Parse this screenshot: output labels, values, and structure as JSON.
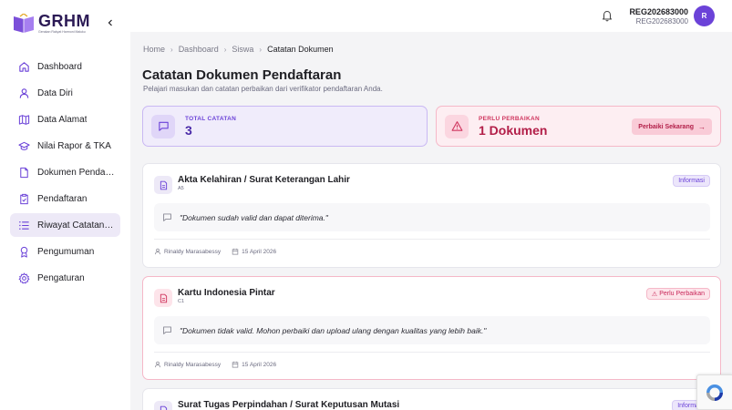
{
  "brand": {
    "name": "GRHM",
    "tagline": "Gerakan Rakyat Harmoni Maluku"
  },
  "sidebar": {
    "items": [
      {
        "label": "Dashboard",
        "icon": "home-icon",
        "active": false
      },
      {
        "label": "Data Diri",
        "icon": "user-icon",
        "active": false
      },
      {
        "label": "Data Alamat",
        "icon": "map-icon",
        "active": false
      },
      {
        "label": "Nilai Rapor & TKA",
        "icon": "graduation-cap-icon",
        "active": false
      },
      {
        "label": "Dokumen Pendaftaran",
        "icon": "file-icon",
        "active": false
      },
      {
        "label": "Pendaftaran",
        "icon": "clipboard-check-icon",
        "active": false
      },
      {
        "label": "Riwayat Catatan Dokumen",
        "icon": "list-icon",
        "active": true
      },
      {
        "label": "Pengumuman",
        "icon": "award-icon",
        "active": false
      },
      {
        "label": "Pengaturan",
        "icon": "gear-icon",
        "active": false
      }
    ]
  },
  "topbar": {
    "user_name": "REG202683000",
    "user_id": "REG202683000",
    "avatar_initial": "R"
  },
  "breadcrumb": [
    "Home",
    "Dashboard",
    "Siswa",
    "Catatan Dokumen"
  ],
  "page": {
    "title": "Catatan Dokumen Pendaftaran",
    "subtitle": "Pelajari masukan dan catatan perbaikan dari verifikator pendaftaran Anda."
  },
  "stats": {
    "total_label": "TOTAL CATATAN",
    "total_value": "3",
    "fix_label": "PERLU PERBAIKAN",
    "fix_value": "1 Dokumen",
    "fix_button": "Perbaiki Sekarang"
  },
  "documents": [
    {
      "title": "Akta Kelahiran / Surat Keterangan Lahir",
      "code": "A5",
      "status": "Informasi",
      "status_type": "info",
      "note": "\"Dokumen sudah valid dan dapat diterima.\"",
      "author": "Rinaldy Marasabessy",
      "date": "15 April 2026"
    },
    {
      "title": "Kartu Indonesia Pintar",
      "code": "C1",
      "status": "Perlu Perbaikan",
      "status_type": "warn",
      "note": "\"Dokumen tidak valid. Mohon perbaiki dan upload ulang dengan kualitas yang lebih baik.\"",
      "author": "Rinaldy Marasabessy",
      "date": "15 April 2026"
    },
    {
      "title": "Surat Tugas Perpindahan / Surat Keputusan Mutasi",
      "status": "Informasi",
      "status_type": "info"
    }
  ],
  "colors": {
    "accent": "#6b42d8",
    "warn": "#d0365f",
    "background": "#f4f4f6"
  }
}
